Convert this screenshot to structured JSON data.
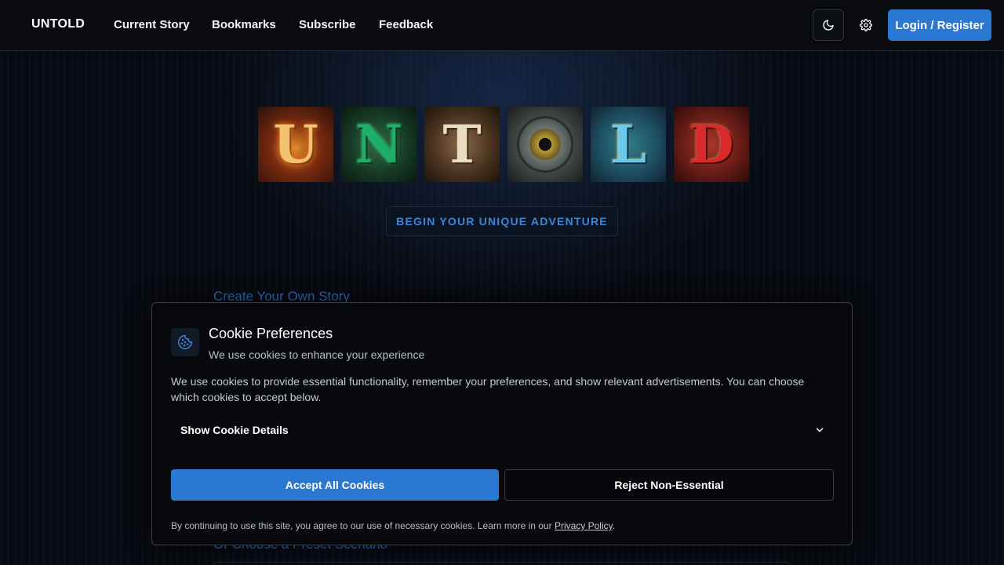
{
  "nav": {
    "brand": "UNTOLD",
    "links": [
      "Current Story",
      "Bookmarks",
      "Subscribe",
      "Feedback"
    ],
    "theme_icon": "moon-icon",
    "settings_icon": "gear-icon",
    "login_label": "Login / Register"
  },
  "hero": {
    "tiles": [
      {
        "letter": "U"
      },
      {
        "letter": "N"
      },
      {
        "letter": "T"
      },
      {
        "letter": "O",
        "icon": "eye-icon"
      },
      {
        "letter": "L"
      },
      {
        "letter": "D"
      }
    ],
    "cta_label": "BEGIN YOUR UNIQUE ADVENTURE"
  },
  "sections": {
    "create_heading": "Create Your Own Story",
    "preset_heading": "Or Choose a Preset Scenario"
  },
  "cookie": {
    "icon": "cookie-icon",
    "title": "Cookie Preferences",
    "subtitle": "We use cookies to enhance your experience",
    "description": "We use cookies to provide essential functionality, remember your preferences, and show relevant advertisements. You can choose which cookies to accept below.",
    "details_label": "Show Cookie Details",
    "accept_label": "Accept All Cookies",
    "reject_label": "Reject Non-Essential",
    "footer_text": "By continuing to use this site, you agree to our use of necessary cookies. Learn more in our ",
    "privacy_link": "Privacy Policy",
    "footer_end": ".",
    "accent_color": "#2a78d2"
  }
}
